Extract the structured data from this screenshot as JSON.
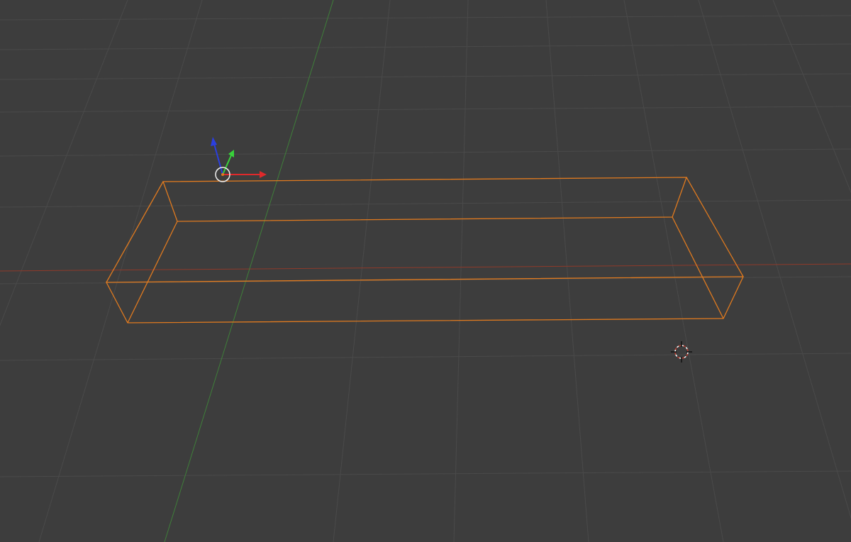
{
  "app": {
    "type": "3d-viewport",
    "mode": "wireframe"
  },
  "colors": {
    "background": "#3d3d3d",
    "grid_line": "#4a4a4a",
    "axis_x": "#9a3b2a",
    "axis_y": "#3f7f3a",
    "selection_outline": "#e07a1f",
    "gizmo_x": "#e0292b",
    "gizmo_y": "#38d23a",
    "gizmo_z": "#2b3fe0",
    "cursor_primary": "#ffffff",
    "cursor_secondary": "#c0392b"
  },
  "icons": {
    "transform_gizmo": "move-gizmo-icon",
    "origin": "object-origin-icon",
    "cursor": "3d-cursor-icon"
  },
  "scene": {
    "selected_object": {
      "shape": "box",
      "selected": true,
      "display": "wireframe"
    }
  }
}
